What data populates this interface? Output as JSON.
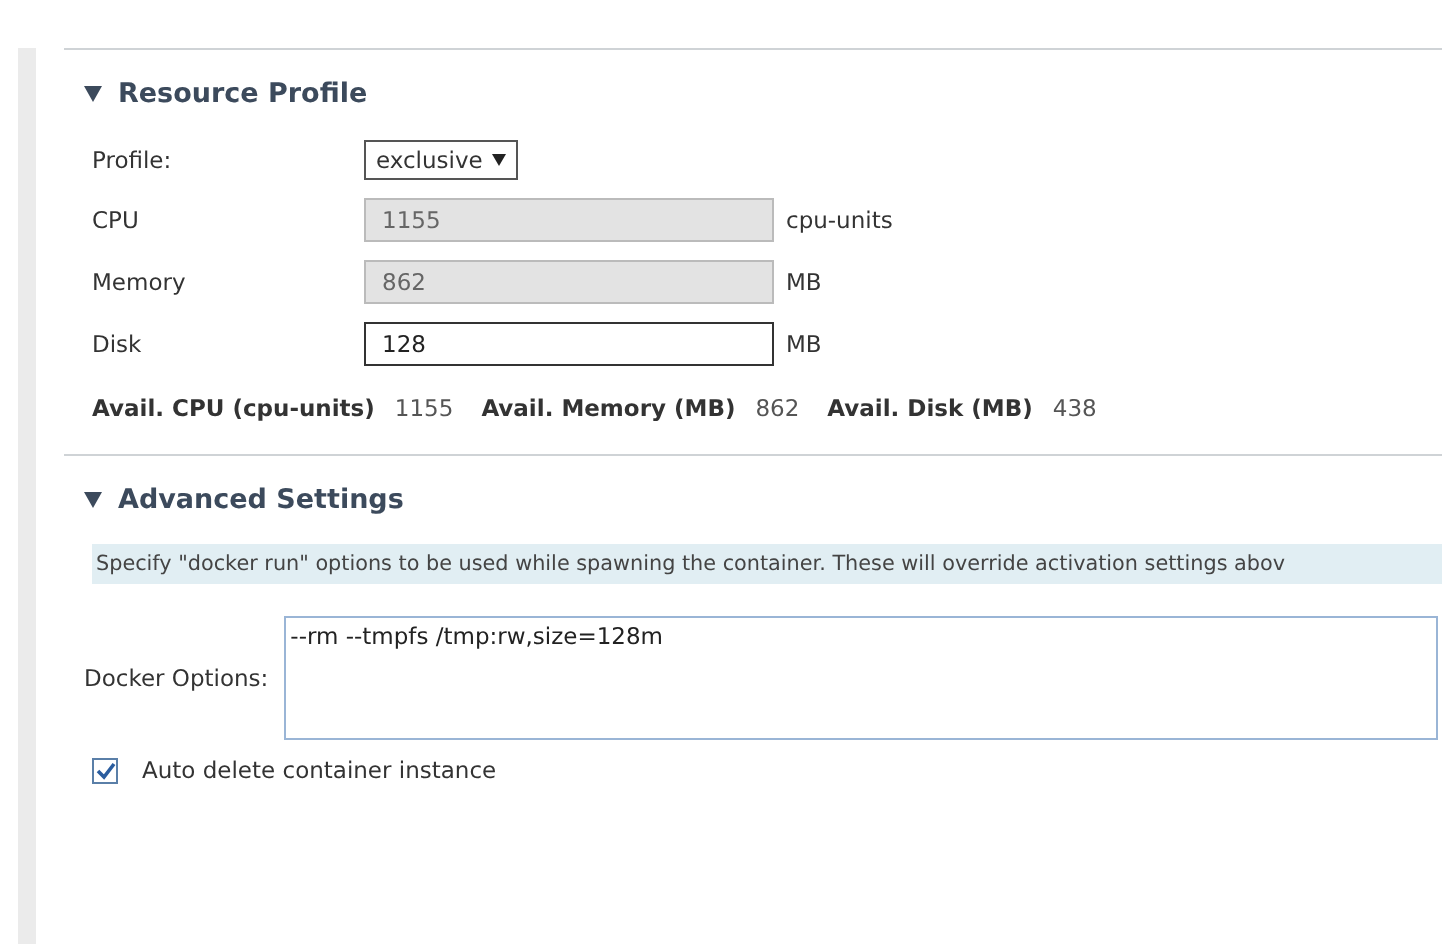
{
  "sections": [
    {
      "kind": "resource",
      "title": "Resource Profile",
      "expanded": true,
      "profile": {
        "label": "Profile:",
        "value": "exclusive"
      },
      "fields": [
        {
          "label": "CPU",
          "value": "1155",
          "unit": "cpu-units",
          "disabled": true
        },
        {
          "label": "Memory",
          "value": "862",
          "unit": "MB",
          "disabled": true
        },
        {
          "label": "Disk",
          "value": "128",
          "unit": "MB",
          "disabled": false
        }
      ],
      "available": [
        {
          "label": "Avail. CPU (cpu-units)",
          "value": "1155"
        },
        {
          "label": "Avail. Memory (MB)",
          "value": "862"
        },
        {
          "label": "Avail. Disk (MB)",
          "value": "438"
        }
      ]
    },
    {
      "kind": "advanced",
      "title": "Advanced Settings",
      "expanded": true,
      "description": "Specify \"docker run\" options to be used while spawning the container. These will override activation settings abov",
      "docker_options": {
        "label": "Docker Options:",
        "value": "--rm --tmpfs /tmp:rw,size=128m"
      },
      "auto_delete": {
        "label": "Auto delete container instance",
        "checked": true
      }
    }
  ]
}
